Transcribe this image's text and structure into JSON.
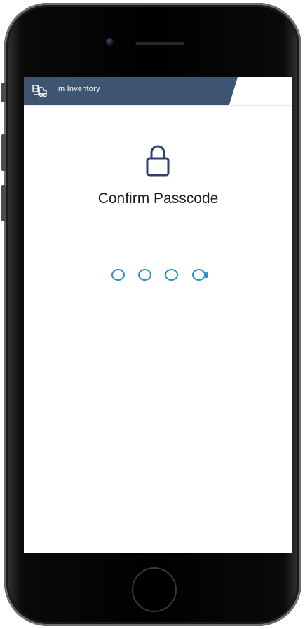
{
  "app": {
    "name": "m Inventory"
  },
  "screen": {
    "title": "Confirm Passcode"
  },
  "passcode": {
    "length": 4,
    "filled": 0,
    "active_index": 3
  },
  "colors": {
    "header_band": "#3d5570",
    "dot_outline": "#2b8fc0",
    "lock_icon": "#2c3e72",
    "title_text": "#1e1e1e"
  },
  "icons": {
    "app": "forklift-icon",
    "lock": "lock-icon"
  }
}
